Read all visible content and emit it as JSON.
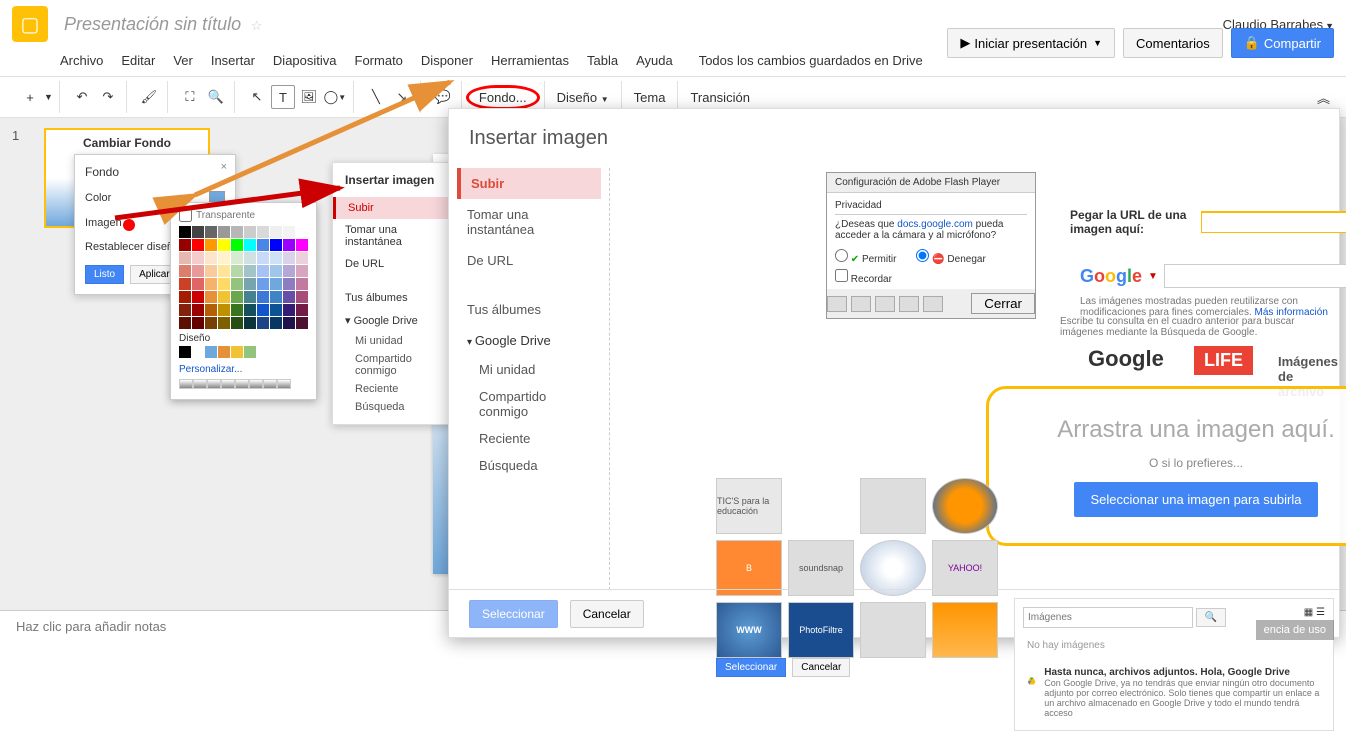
{
  "header": {
    "doc_title": "Presentación sin título",
    "user": "Claudio Barrabes"
  },
  "menu": [
    "Archivo",
    "Editar",
    "Ver",
    "Insertar",
    "Diapositiva",
    "Formato",
    "Disponer",
    "Herramientas",
    "Tabla",
    "Ayuda"
  ],
  "save_status": "Todos los cambios guardados en Drive",
  "buttons": {
    "present": "Iniciar presentación",
    "comments": "Comentarios",
    "share": "Compartir"
  },
  "toolbar": {
    "fondo": "Fondo...",
    "diseno": "Diseño",
    "tema": "Tema",
    "transicion": "Transición"
  },
  "slide_thumb": "Cambiar Fondo",
  "notes": "Haz clic para añadir notas",
  "fondo_dialog": {
    "title": "Fondo",
    "color": "Color",
    "imagen": "Imagen",
    "reset": "Restablecer diseño",
    "listo": "Listo",
    "aplicar": "Aplicar"
  },
  "color_picker": {
    "transparent": "Transparente",
    "design": "Diseño",
    "custom": "Personalizar..."
  },
  "insert_small": {
    "title": "Insertar imagen",
    "items": [
      "Subir",
      "Tomar una instantánea",
      "De URL"
    ],
    "albums": "Tus álbumes",
    "drive": "Google Drive",
    "drive_items": [
      "Mi unidad",
      "Compartido conmigo",
      "Reciente",
      "Búsqueda"
    ]
  },
  "insert_large": {
    "title": "Insertar imagen",
    "items": [
      "Subir",
      "Tomar una instantánea",
      "De URL"
    ],
    "albums": "Tus álbumes",
    "drive": "Google Drive",
    "drive_items": [
      "Mi unidad",
      "Compartido conmigo",
      "Reciente",
      "Búsqueda"
    ],
    "url_label": "Pegar la URL de una imagen aquí:",
    "google_note1": "Las imágenes mostradas pueden reutilizarse con modificaciones para fines comerciales.",
    "google_link": "Más información",
    "google_note2": "Escribe tu consulta en el cuadro anterior para buscar imágenes mediante la Búsqueda de Google.",
    "stock": "Imágenes de archivo",
    "drop_zone": {
      "main": "Arrastra una imagen aquí.",
      "or": "O si lo prefieres...",
      "button": "Seleccionar una imagen para subirla"
    },
    "search_placeholder": "Imágenes",
    "no_images": "No hay imágenes",
    "promo_title": "Hasta nunca, archivos adjuntos. Hola, Google Drive",
    "promo_text": "Con Google Drive, ya no tendrás que enviar ningún otro documento adjunto por correo electrónico. Solo tienes que compartir un enlace a un archivo almacenado en Google Drive y todo el mundo tendrá acceso",
    "seleccionar_small": "Seleccionar",
    "cancelar_small": "Cancelar",
    "seleccionar": "Seleccionar",
    "cancelar": "Cancelar"
  },
  "flash": {
    "title": "Configuración de Adobe Flash Player",
    "tab": "Privacidad",
    "question": "¿Deseas que docs.google.com pueda acceder a la cámara y al micrófono?",
    "link": "docs.google.com",
    "allow": "Permitir",
    "deny": "Denegar",
    "remember": "Recordar",
    "close": "Cerrar"
  },
  "albums_crumb": "TIC'S para la educación",
  "cancia": "encia de uso"
}
